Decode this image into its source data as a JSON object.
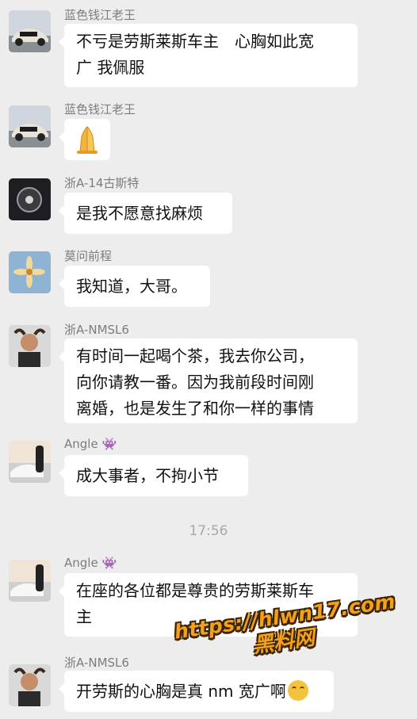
{
  "messages": [
    {
      "sender": "蓝色钱江老王",
      "lines": [
        "不亏是劳斯莱斯车主　心胸如此宽",
        "广 我佩服"
      ]
    },
    {
      "sender": "蓝色钱江老王",
      "emoji": "folded-hands"
    },
    {
      "sender": "浙A-14古斯特",
      "lines": [
        "是我不愿意找麻烦"
      ]
    },
    {
      "sender": "莫问前程",
      "lines": [
        "我知道，大哥。"
      ]
    },
    {
      "sender": "浙A-NMSL6",
      "lines": [
        "有时间一起喝个茶，我去你公司，",
        "向你请教一番。因为我前段时间刚",
        "离婚，也是发生了和你一样的事情"
      ]
    },
    {
      "sender": "Angle 👾",
      "lines": [
        "成大事者，不拘小节"
      ]
    },
    {
      "sender": "Angle 👾",
      "lines": [
        "在座的各位都是尊贵的劳斯莱斯车",
        "主"
      ]
    },
    {
      "sender": "浙A-NMSL6",
      "lines": [
        "开劳斯的心胸是真 nm 宽广啊"
      ],
      "trailing_emoji": "grinning-sweat"
    }
  ],
  "timestamp": "17:56",
  "watermark": {
    "url": "https://hlwn17.com",
    "cn": "黑料网"
  },
  "colors": {
    "background": "#ededed",
    "bubble": "#ffffff",
    "watermark": "#f3a11a"
  }
}
